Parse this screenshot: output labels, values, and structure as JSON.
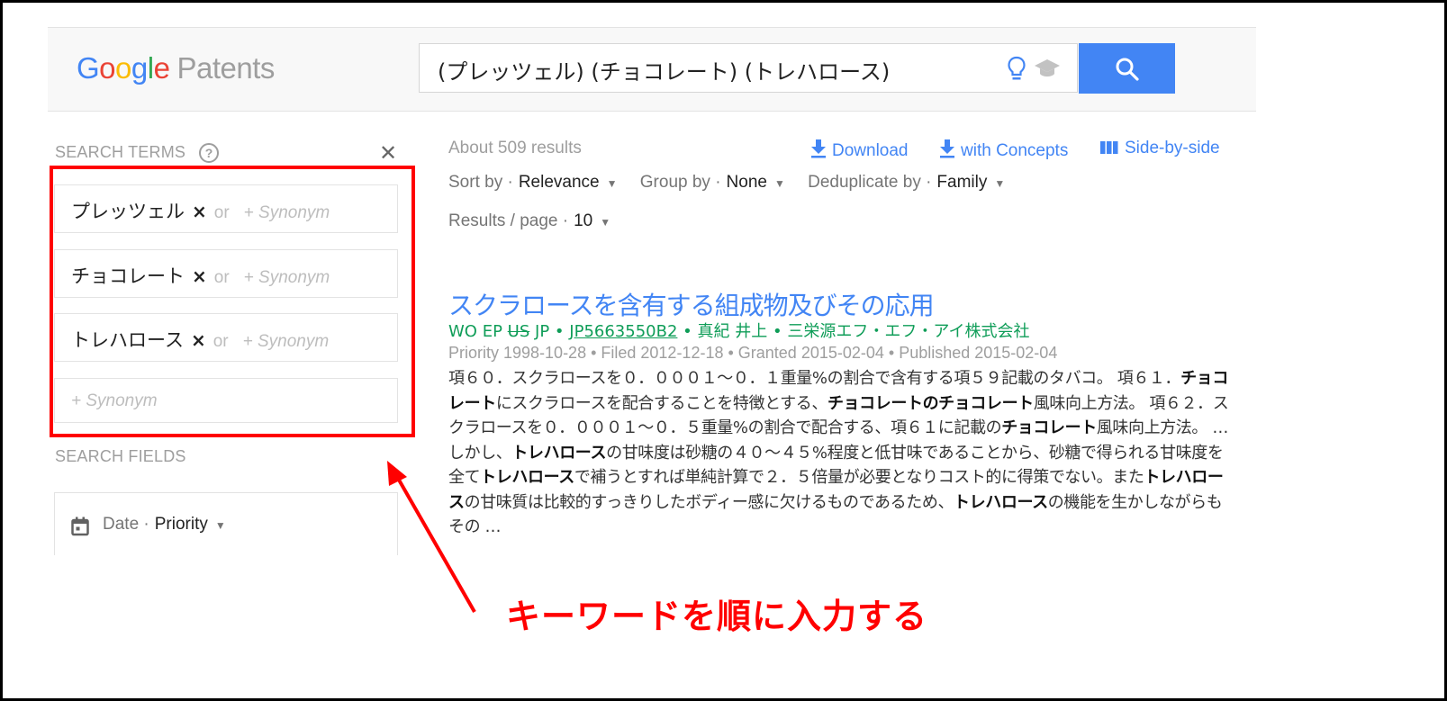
{
  "header": {
    "logo_letters": [
      "G",
      "o",
      "o",
      "g",
      "l",
      "e"
    ],
    "logo_product": "Patents",
    "search_value": "(プレッツェル) (チョコレート) (トレハロース)",
    "icons": [
      "lightbulb-icon",
      "graduation-cap-icon",
      "search-icon"
    ]
  },
  "left_panel": {
    "search_terms_label": "SEARCH TERMS",
    "help_glyph": "?",
    "clear_glyph": "✕",
    "terms": [
      {
        "term": "プレッツェル",
        "remove": "×",
        "or": "or",
        "synonym": "+ Synonym"
      },
      {
        "term": "チョコレート",
        "remove": "×",
        "or": "or",
        "synonym": "+ Synonym"
      },
      {
        "term": "トレハロース",
        "remove": "×",
        "or": "or",
        "synonym": "+ Synonym"
      }
    ],
    "empty_synonym": "+ Synonym",
    "search_fields_label": "SEARCH FIELDS",
    "date_field": {
      "label": "Date ·",
      "value": "Priority",
      "caret": "▼"
    }
  },
  "results_header": {
    "count": "About 509 results",
    "download": "Download",
    "with_concepts": "with Concepts",
    "side_by_side": "Side-by-side",
    "sort_label": "Sort by ·",
    "sort_value": "Relevance",
    "group_label": "Group by ·",
    "group_value": "None",
    "dedupe_label": "Deduplicate by ·",
    "dedupe_value": "Family",
    "per_page_label": "Results / page ·",
    "per_page_value": "10",
    "caret": "▼"
  },
  "result": {
    "title": "スクラロースを含有する組成物及びその応用",
    "offices": [
      "WO",
      "EP",
      "US",
      "JP"
    ],
    "struck_office": "US",
    "sep": "•",
    "publication": "JP5663550B2",
    "inventor": "真紀 井上",
    "assignee": "三栄源エフ・エフ・アイ株式会社",
    "dates": "Priority 1998-10-28 • Filed 2012-12-18 • Granted 2015-02-04 • Published 2015-02-04",
    "snippet_parts": [
      {
        "t": "項６０．スクラロースを０．０００１～０．１重量%の割合で含有する項５９記載のタバコ。 項６１．",
        "b": false
      },
      {
        "t": "チョコレート",
        "b": true
      },
      {
        "t": "にスクラロースを配合することを特徴とする、",
        "b": false
      },
      {
        "t": "チョコレートのチョコレート",
        "b": true
      },
      {
        "t": "風味向上方法。 項６２．スクラロースを０．０００１～０．５重量%の割合で配合する、項６１に記載の",
        "b": false
      },
      {
        "t": "チョコレート",
        "b": true
      },
      {
        "t": "風味向上方法。 … しかし、",
        "b": false
      },
      {
        "t": "トレハロース",
        "b": true
      },
      {
        "t": "の甘味度は砂糖の４０～４５%程度と低甘味であることから、砂糖で得られる甘味度を全て",
        "b": false
      },
      {
        "t": "トレハロース",
        "b": true
      },
      {
        "t": "で補うとすれば単純計算で２．５倍量が必要となりコスト的に得策でない。また",
        "b": false
      },
      {
        "t": "トレハロース",
        "b": true
      },
      {
        "t": "の甘味質は比較的すっきりしたボディー感に欠けるものであるため、",
        "b": false
      },
      {
        "t": "トレハロース",
        "b": true
      },
      {
        "t": "の機能を生かしながらもその …",
        "b": false
      }
    ]
  },
  "annotation": {
    "text": "キーワードを順に入力する",
    "color": "#ff0000"
  },
  "colors": {
    "google_blue": "#4285f4",
    "google_red": "#ea4335",
    "google_yellow": "#fbbc05",
    "google_green": "#34a853",
    "meta_green": "#0f9d58"
  }
}
